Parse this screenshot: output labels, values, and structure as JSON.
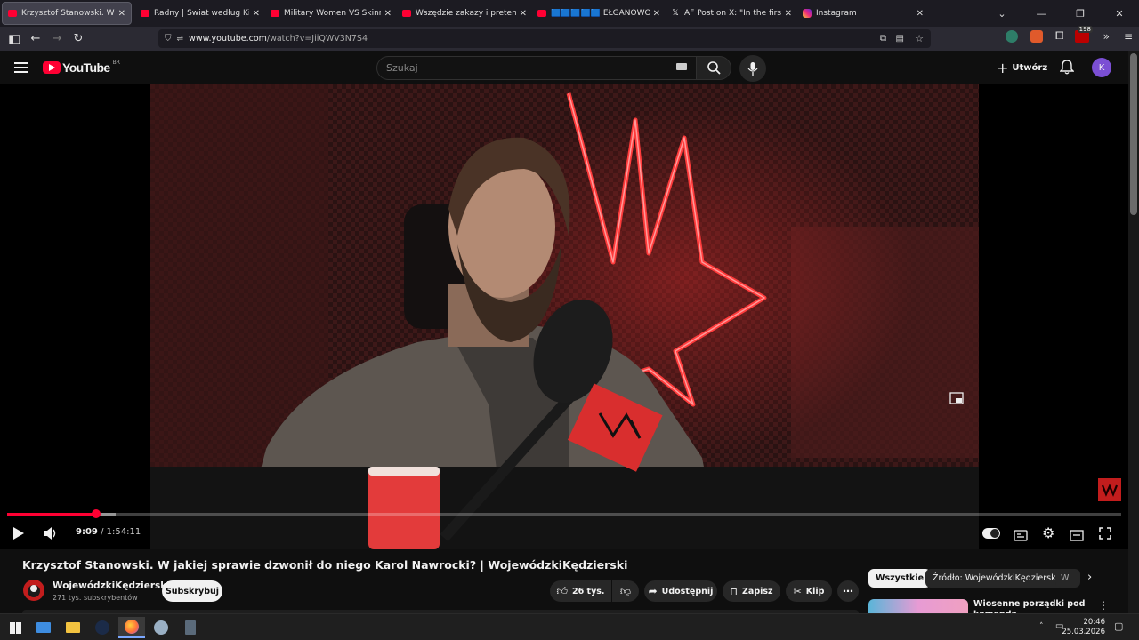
{
  "browser": {
    "tabs": [
      {
        "title": "Krzysztof Stanowski. W jakiej sprawie",
        "icon": "youtube-icon",
        "active": true
      },
      {
        "title": "Radny | Świat według Kiepskich",
        "icon": "youtube-icon",
        "active": false
      },
      {
        "title": "Military Women VS Skinny Joes",
        "icon": "youtube-icon",
        "active": false
      },
      {
        "title": "Wszędzie zakazy i pretensje! Lu",
        "icon": "youtube-icon",
        "active": false
      },
      {
        "title": "🟦🟦🟦🟦🟦 EŁGANOWO: D",
        "icon": "youtube-icon",
        "active": false
      },
      {
        "title": "AF Post on X: \"In the first nine m",
        "icon": "x-icon",
        "active": false
      },
      {
        "title": "Instagram",
        "icon": "instagram-icon",
        "active": false
      }
    ],
    "url_host": "www.youtube.com",
    "url_path": "/watch?v=JiiQWV3N7S4",
    "extension_badge": "198"
  },
  "youtube": {
    "logo_text": "YouTube",
    "region": "BR",
    "search_placeholder": "Szukaj",
    "create_label": "Utwórz",
    "avatar_letter": "K"
  },
  "player": {
    "time_current": "9:09",
    "time_total": "1:54:11",
    "time_separator": "/",
    "progress_fraction": 0.0798,
    "buffered_fraction": 0.0975,
    "accent": "#ff0033"
  },
  "video": {
    "title": "Krzysztof Stanowski. W jakiej sprawie dzwonił do niego Karol Nawrocki? | WojewódzkiKędzierski",
    "channel_name": "WojewódzkiKędzierski",
    "subscribers": "271 tys. subskrybentów",
    "subscribe_label": "Subskrybuj",
    "like_count": "26 tys.",
    "share_label": "Udostępnij",
    "save_label": "Zapisz",
    "clip_label": "Klip"
  },
  "sidebar": {
    "chips": [
      "Wszystkie",
      "Źródło: WojewódzkiKędzierski",
      "Wi"
    ],
    "first_video_title": "Wiosenne porządki pod komenda"
  },
  "taskbar": {
    "time": "20:46",
    "date": "25.03.2026"
  }
}
